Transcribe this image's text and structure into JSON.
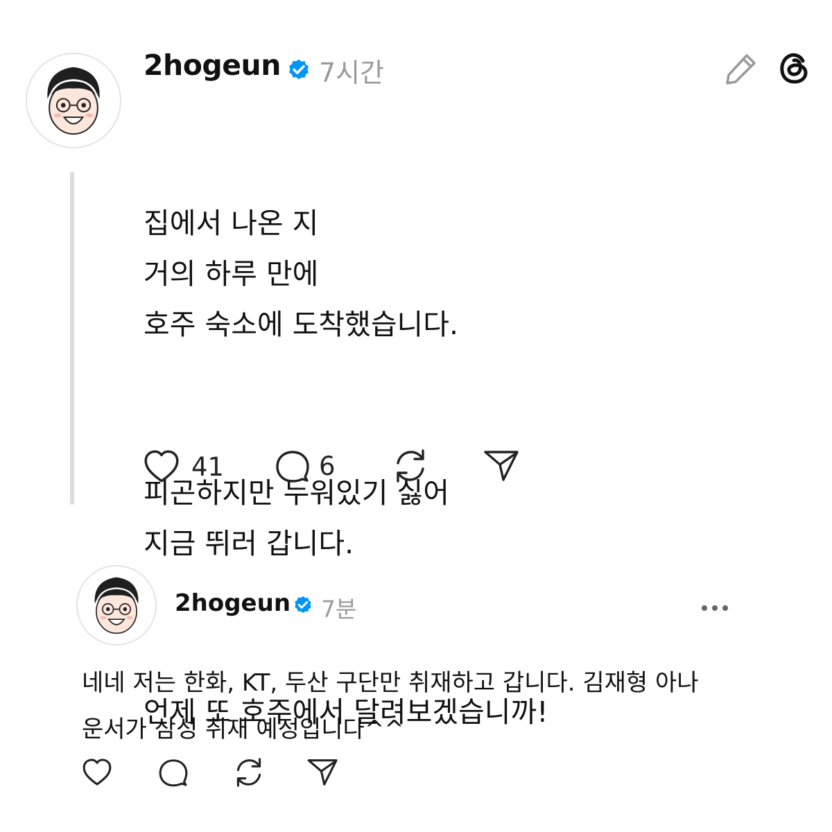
{
  "post": {
    "username": "2hogeun",
    "time": "7시간",
    "paragraphs": [
      "집에서 나온 지\n거의 하루 만에\n호주 숙소에 도착했습니다.",
      "피곤하지만 누워있기 싫어\n지금 뛰러 갑니다.",
      "언제 또 호주에서 달려보겠습니까!"
    ],
    "like_count": "41",
    "reply_count": "6"
  },
  "reply": {
    "username": "2hogeun",
    "time": "7분",
    "text": "네네 저는 한화, KT, 두산 구단만 취재하고 갑니다. 김재형 아나\n운서가 삼성 취재 예정입니다^^"
  },
  "colors": {
    "verified_badge": "#0095f6",
    "muted_text": "#9a9a9a",
    "thread_line": "#dcdcdc"
  },
  "icons": [
    "edit-pencil-icon",
    "threads-logo-icon",
    "verified-badge-icon",
    "heart-icon",
    "comment-icon",
    "repost-icon",
    "share-icon",
    "more-options-icon"
  ]
}
